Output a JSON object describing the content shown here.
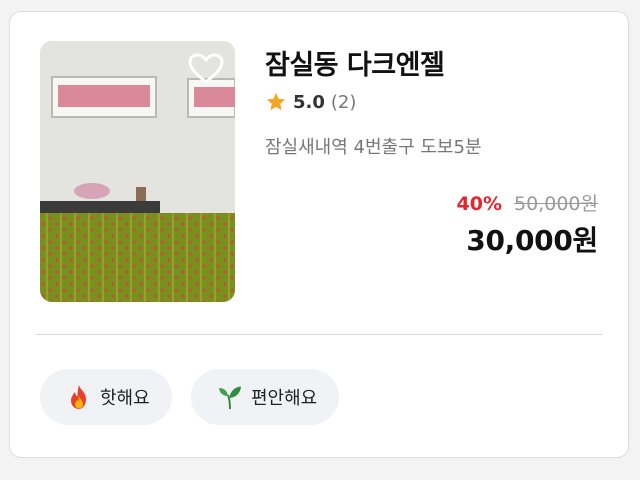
{
  "listing": {
    "title": "잠실동 다크엔젤",
    "rating_score": "5.0",
    "rating_count": "(2)",
    "location": "잠실새내역 4번출구 도보5분",
    "discount_rate": "40%",
    "original_price": "50,000원",
    "price": "30,000원",
    "image_icon": "room-photo",
    "favorite_icon": "heart-outline-icon"
  },
  "tags": [
    {
      "label": "핫해요",
      "icon": "fire-icon"
    },
    {
      "label": "편안해요",
      "icon": "sprout-icon"
    }
  ],
  "colors": {
    "discount": "#e5262f",
    "star": "#f5a623",
    "tag_background": "#f1f2f5"
  }
}
